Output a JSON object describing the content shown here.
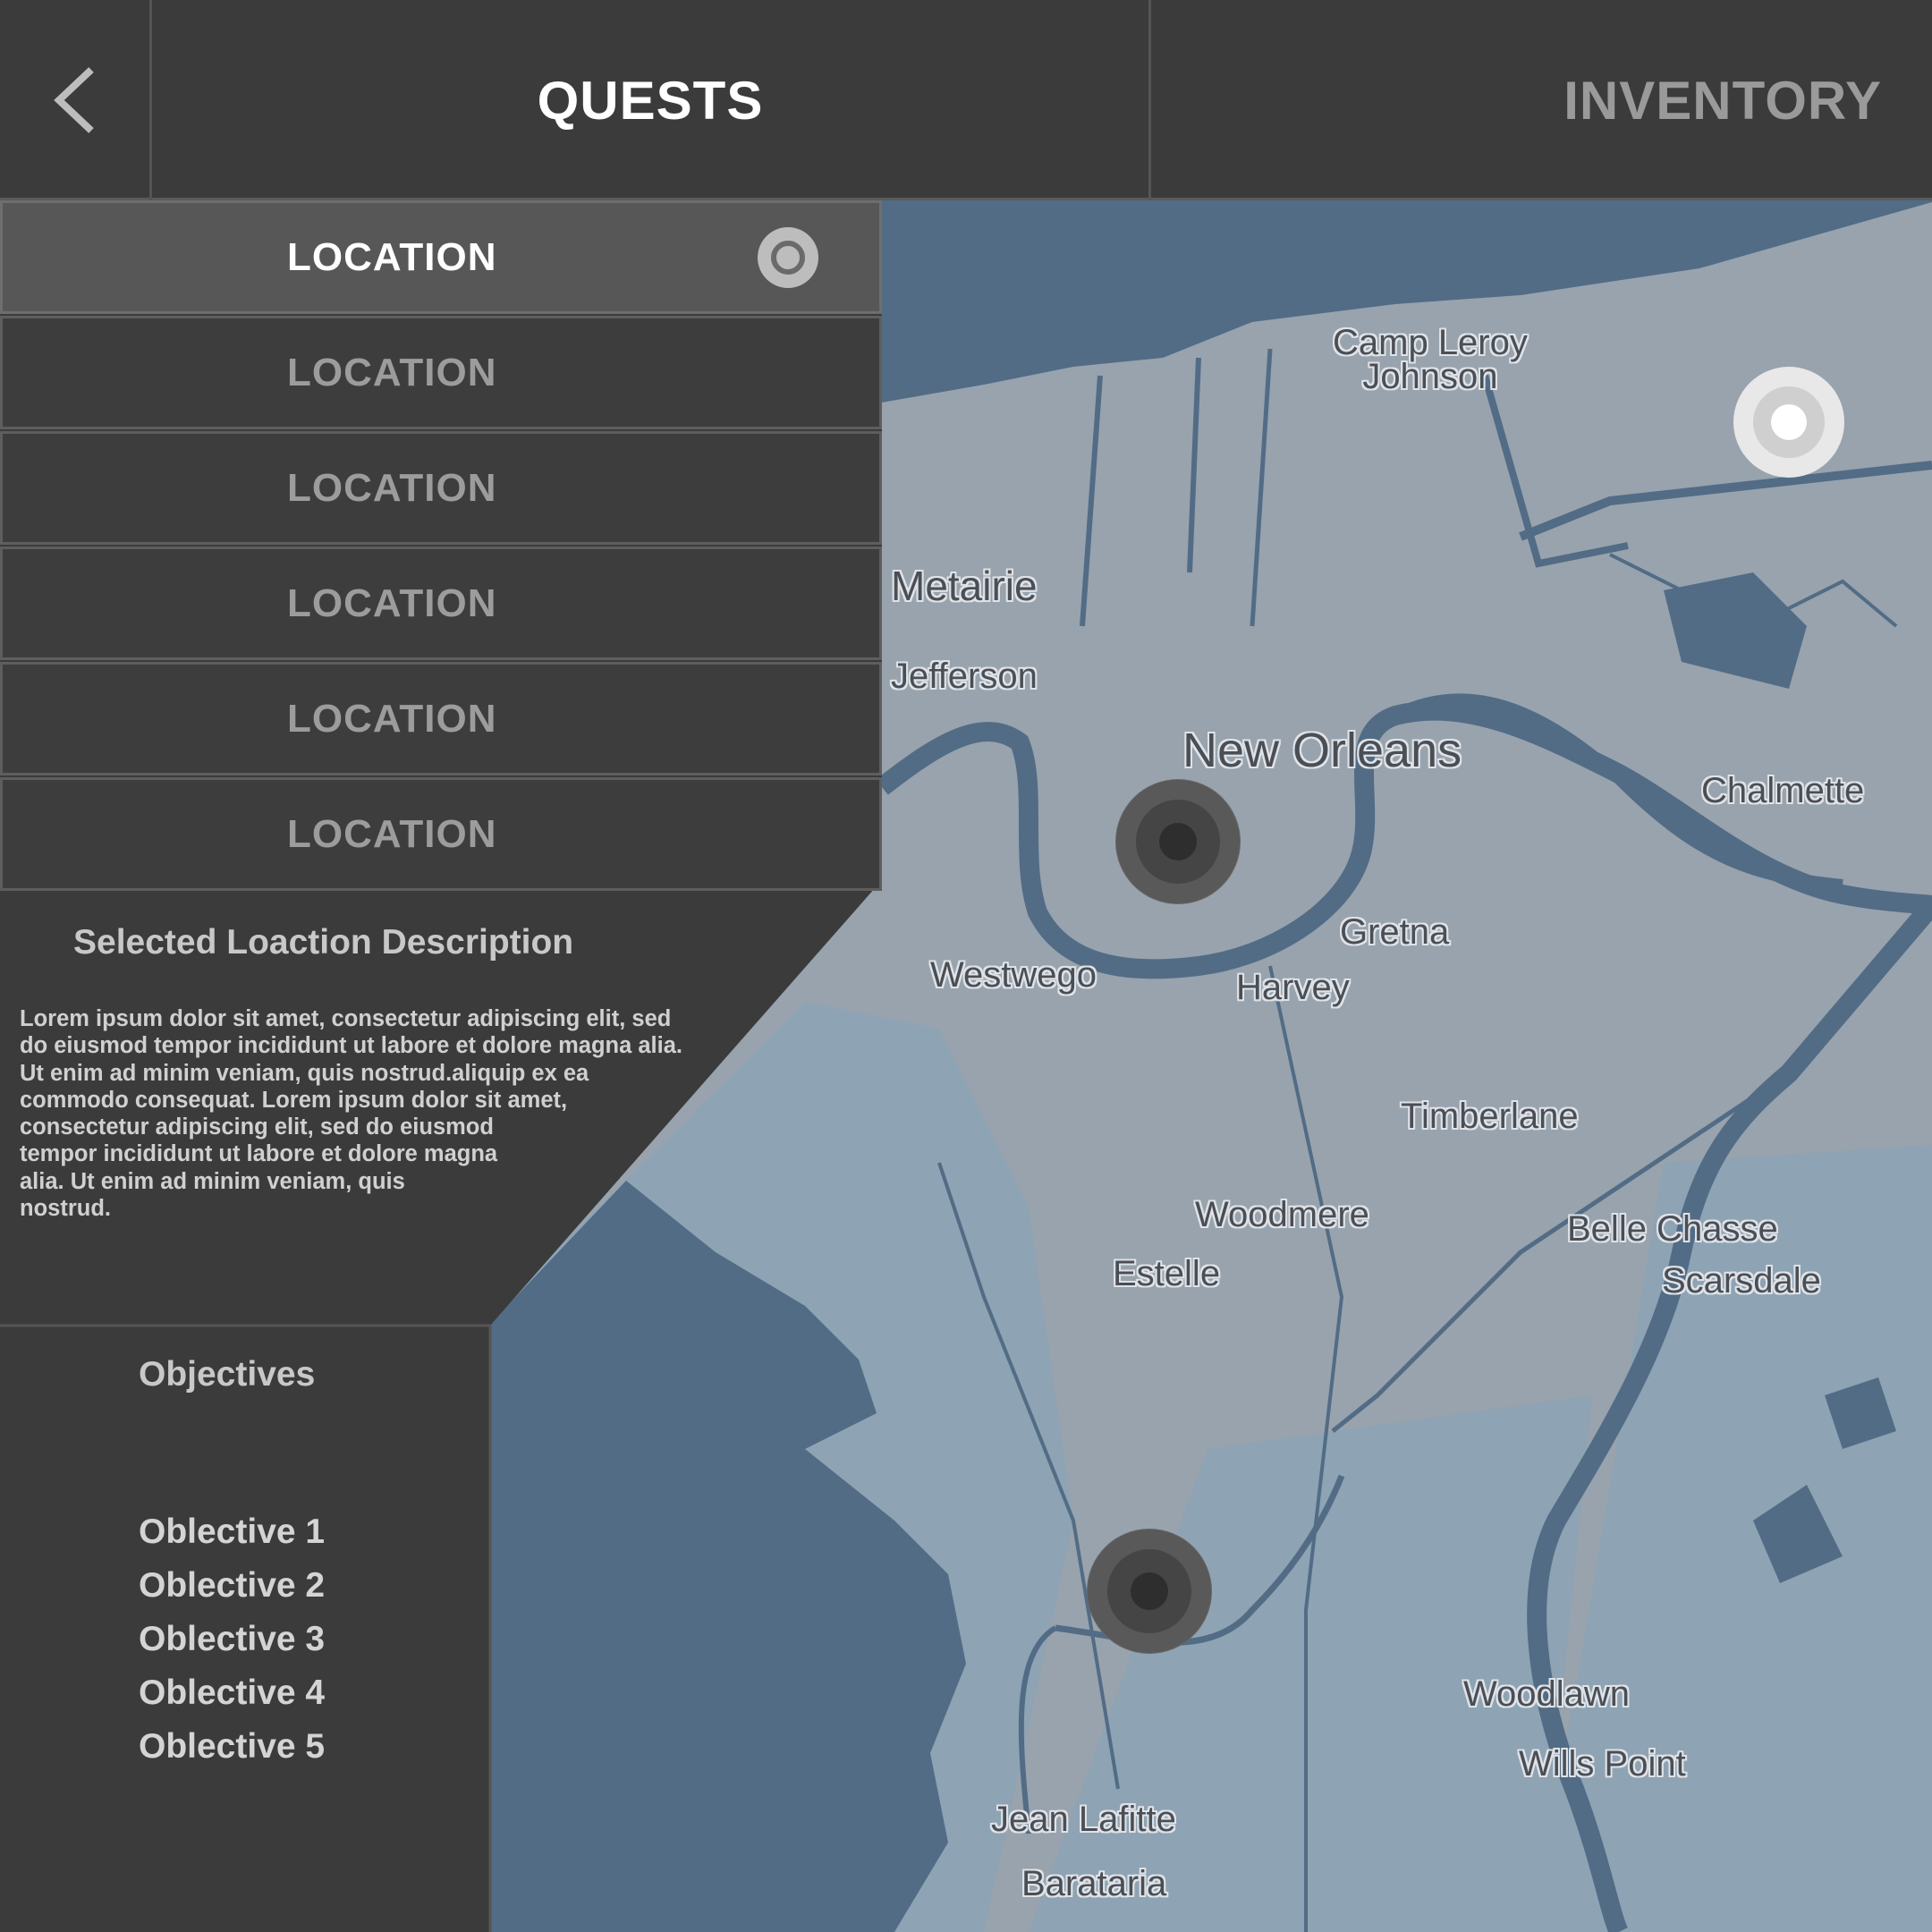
{
  "header": {
    "back_icon": "chevron-left-icon",
    "tabs": [
      {
        "label": "QUESTS",
        "active": true
      },
      {
        "label": "INVENTORY",
        "active": false
      }
    ]
  },
  "locations": [
    {
      "label": "LOCATION",
      "selected": true
    },
    {
      "label": "LOCATION",
      "selected": false
    },
    {
      "label": "LOCATION",
      "selected": false
    },
    {
      "label": "LOCATION",
      "selected": false
    },
    {
      "label": "LOCATION",
      "selected": false
    },
    {
      "label": "LOCATION",
      "selected": false
    }
  ],
  "description": {
    "title": "Selected Loaction Description",
    "text": "Lorem ipsum dolor sit amet, consectetur adipiscing elit, sed\ndo eiusmod tempor incididunt ut labore et dolore magna alia.\nUt enim ad minim veniam, quis nostrud.aliquip ex ea\ncommodo consequat. Lorem ipsum dolor sit amet,\nconsectetur adipiscing elit, sed do eiusmod\ntempor incididunt ut labore et dolore magna\nalia. Ut enim ad minim veniam, quis\nnostrud."
  },
  "objectives": {
    "title": "Objectives",
    "items": [
      "Oblective 1",
      "Oblective 2",
      "Oblective 3",
      "Oblective 4",
      "Oblective 5"
    ]
  },
  "map": {
    "places": {
      "camp_leroy_johnson": "Camp Leroy\nJohnson",
      "metairie": "Metairie",
      "jefferson": "Jefferson",
      "new_orleans": "New Orleans",
      "chalmette": "Chalmette",
      "gretna": "Gretna",
      "westwego": "Westwego",
      "harvey": "Harvey",
      "timberlane": "Timberlane",
      "woodmere": "Woodmere",
      "estelle": "Estelle",
      "belle_chasse": "Belle Chasse",
      "scarsdale": "Scarsdale",
      "woodlawn": "Woodlawn",
      "wills_point": "Wills Point",
      "jean_lafitte": "Jean Lafitte",
      "barataria": "Barataria"
    },
    "colors": {
      "land": "#98a3ad",
      "marsh": "#8ea3b3",
      "water": "#526c86",
      "panel": "#3b3b3b"
    }
  }
}
